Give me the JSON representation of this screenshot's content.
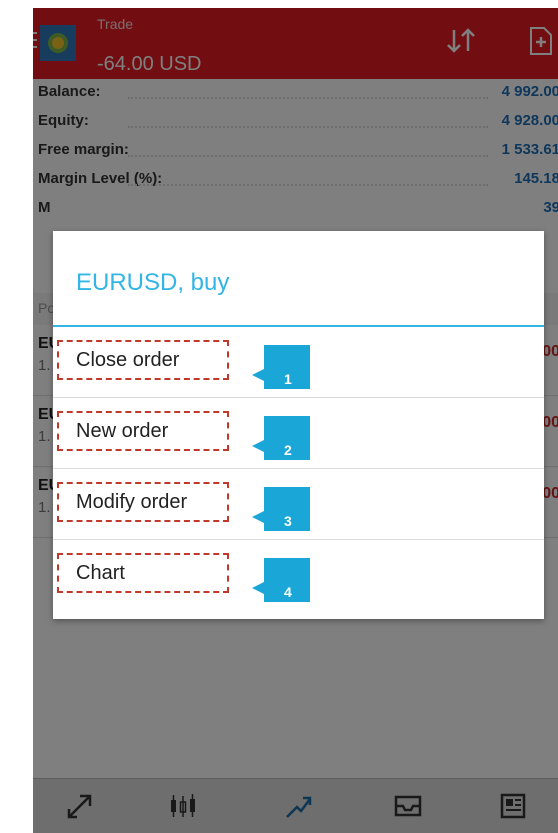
{
  "header": {
    "title_small": "Trade",
    "title_big": "-64.00 USD"
  },
  "info": [
    {
      "label": "Balance:",
      "value": "4 992.00"
    },
    {
      "label": "Equity:",
      "value": "4 928.00"
    },
    {
      "label": "Free margin:",
      "value": "1 533.61"
    },
    {
      "label": "Margin Level (%):",
      "value": "145.18"
    },
    {
      "label": "M",
      "value": "39"
    }
  ],
  "positions": {
    "header": "Po",
    "rows": [
      {
        "symbol": "EU",
        "sub": "1.",
        "profit": "00"
      },
      {
        "symbol": "EU",
        "sub": "1.",
        "profit": "00"
      },
      {
        "symbol": "EU",
        "sub": "1.",
        "profit": "00"
      }
    ]
  },
  "dialog": {
    "title": "EURUSD, buy",
    "items": [
      {
        "label": "Close order",
        "badge": "1"
      },
      {
        "label": "New order",
        "badge": "2"
      },
      {
        "label": "Modify order",
        "badge": "3"
      },
      {
        "label": "Chart",
        "badge": "4"
      }
    ]
  },
  "bottom_nav": [
    "quotes-icon",
    "chart-icon",
    "trade-icon",
    "history-icon",
    "news-icon"
  ],
  "colors": {
    "header": "#e51c23",
    "accent": "#33b5e5",
    "badge": "#1aa7d8",
    "marker": "#c0392b",
    "value": "#1f6fb7"
  }
}
